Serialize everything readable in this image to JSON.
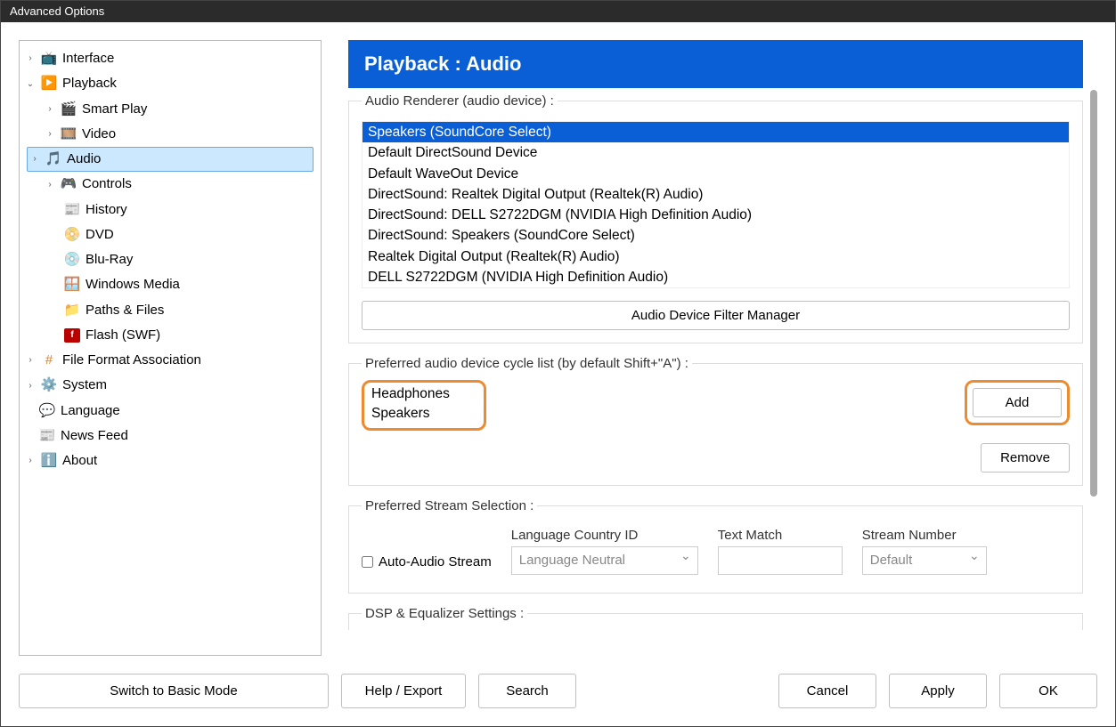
{
  "window": {
    "title": "Advanced Options"
  },
  "tree": {
    "interface": "Interface",
    "playback": "Playback",
    "smart_play": "Smart Play",
    "video": "Video",
    "audio": "Audio",
    "controls": "Controls",
    "history": "History",
    "dvd": "DVD",
    "blu_ray": "Blu-Ray",
    "windows_media": "Windows Media",
    "paths_files": "Paths & Files",
    "flash": "Flash (SWF)",
    "file_format": "File Format Association",
    "system": "System",
    "language": "Language",
    "news_feed": "News Feed",
    "about": "About"
  },
  "header": {
    "title": "Playback : Audio"
  },
  "renderer": {
    "legend": "Audio Renderer (audio device) :",
    "items": [
      "Speakers (SoundCore Select)",
      "Default DirectSound Device",
      "Default WaveOut Device",
      "DirectSound: Realtek Digital Output (Realtek(R) Audio)",
      "DirectSound: DELL S2722DGM (NVIDIA High Definition Audio)",
      "DirectSound: Speakers (SoundCore Select)",
      "Realtek Digital Output (Realtek(R) Audio)",
      "DELL S2722DGM (NVIDIA High Definition Audio)"
    ],
    "filter_button": "Audio Device Filter Manager"
  },
  "cycle": {
    "legend": "Preferred audio device cycle list (by default Shift+\"A\") :",
    "items": [
      "Headphones",
      "Speakers"
    ],
    "add": "Add",
    "remove": "Remove"
  },
  "stream": {
    "legend": "Preferred Stream Selection :",
    "auto_label": "Auto-Audio Stream",
    "lang_label": "Language Country ID",
    "lang_value": "Language Neutral",
    "text_label": "Text Match",
    "num_label": "Stream Number",
    "num_value": "Default"
  },
  "dsp": {
    "legend": "DSP & Equalizer Settings :"
  },
  "footer": {
    "basic": "Switch to Basic Mode",
    "help": "Help / Export",
    "search": "Search",
    "cancel": "Cancel",
    "apply": "Apply",
    "ok": "OK"
  }
}
